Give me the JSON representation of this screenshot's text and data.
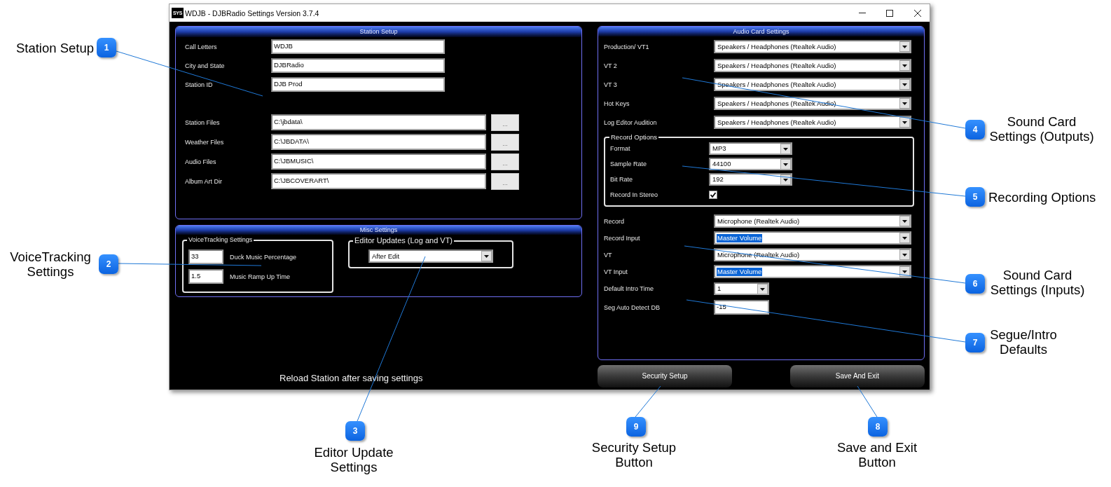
{
  "window": {
    "app_icon_text": "SYS",
    "title": "WDJB - DJBRadio Settings Version 3.7.4"
  },
  "station_setup": {
    "title": "Station Setup",
    "fields": [
      {
        "label": "Call Letters",
        "value": "WDJB"
      },
      {
        "label": "City and State",
        "value": "DJBRadio"
      },
      {
        "label": "Station ID",
        "value": "DJB Prod"
      }
    ],
    "folders": [
      {
        "label": "Station Files",
        "value": "C:\\jbdata\\",
        "button": "..."
      },
      {
        "label": "Weather Files",
        "value": "C:\\JBDATA\\",
        "button": "..."
      },
      {
        "label": "Audio Files",
        "value": "C:\\JBMUSIC\\",
        "button": "..."
      },
      {
        "label": "Album Art Dir",
        "value": "C:\\JBCOVERART\\",
        "button": "..."
      }
    ]
  },
  "misc_settings": {
    "title": "Misc Settings",
    "voicetracking": {
      "title": "VoiceTracking Settings",
      "fields": [
        {
          "value": "33",
          "label": "Duck Music Percentage"
        },
        {
          "value": "1.5",
          "label": "Music Ramp Up Time"
        }
      ]
    },
    "editor_updates": {
      "title": "Editor Updates (Log and VT)",
      "value": "After Edit"
    }
  },
  "footer_note": "Reload Station after saving settings",
  "audio_card_settings": {
    "title": "Audio Card Settings",
    "outputs": [
      {
        "label": "Production/ VT1",
        "value": "Speakers / Headphones (Realtek Audio)"
      },
      {
        "label": "VT 2",
        "value": "Speakers / Headphones (Realtek Audio)"
      },
      {
        "label": "VT 3",
        "value": "Speakers / Headphones (Realtek Audio)"
      },
      {
        "label": "Hot Keys",
        "value": "Speakers / Headphones (Realtek Audio)"
      },
      {
        "label": "Log Editor Audition",
        "value": "Speakers / Headphones (Realtek Audio)"
      }
    ],
    "record_options": {
      "title": "Record Options",
      "rows": [
        {
          "kind": "dropdown",
          "label": "Format",
          "value": "MP3"
        },
        {
          "kind": "dropdown",
          "label": "Sample Rate",
          "value": "44100"
        },
        {
          "kind": "dropdown",
          "label": "Bit Rate",
          "value": "192"
        },
        {
          "kind": "checkbox",
          "label": "Record In Stereo",
          "checked": true
        }
      ]
    },
    "inputs": [
      {
        "label": "Record",
        "value": "Microphone (Realtek Audio)",
        "highlighted": false
      },
      {
        "label": "Record Input",
        "value": "Master Volume",
        "highlighted": true
      },
      {
        "label": "VT",
        "value": "Microphone (Realtek Audio)",
        "highlighted": false
      },
      {
        "label": "VT Input",
        "value": "Master Volume",
        "highlighted": true
      }
    ],
    "defaults": [
      {
        "kind": "dropdown",
        "label": "Default Intro Time",
        "value": "1"
      },
      {
        "kind": "field",
        "label": "Seg Auto Detect DB",
        "value": "-15"
      }
    ]
  },
  "buttons": [
    {
      "label": "Security Setup"
    },
    {
      "label": "Save And Exit"
    }
  ],
  "callouts": [
    {
      "number": "1",
      "text": "Station Setup"
    },
    {
      "number": "4",
      "text": "Sound Card Settings (Outputs)"
    },
    {
      "number": "5",
      "text": "Recording Options"
    },
    {
      "number": "2",
      "text": "VoiceTracking Settings"
    },
    {
      "number": "6",
      "text": "Sound Card Settings (Inputs)"
    },
    {
      "number": "7",
      "text": "Segue/Intro Defaults"
    },
    {
      "number": "3",
      "text": "Editor Update Settings"
    },
    {
      "number": "9",
      "text": "Security Setup Button"
    },
    {
      "number": "8",
      "text": "Save and Exit Button"
    }
  ]
}
